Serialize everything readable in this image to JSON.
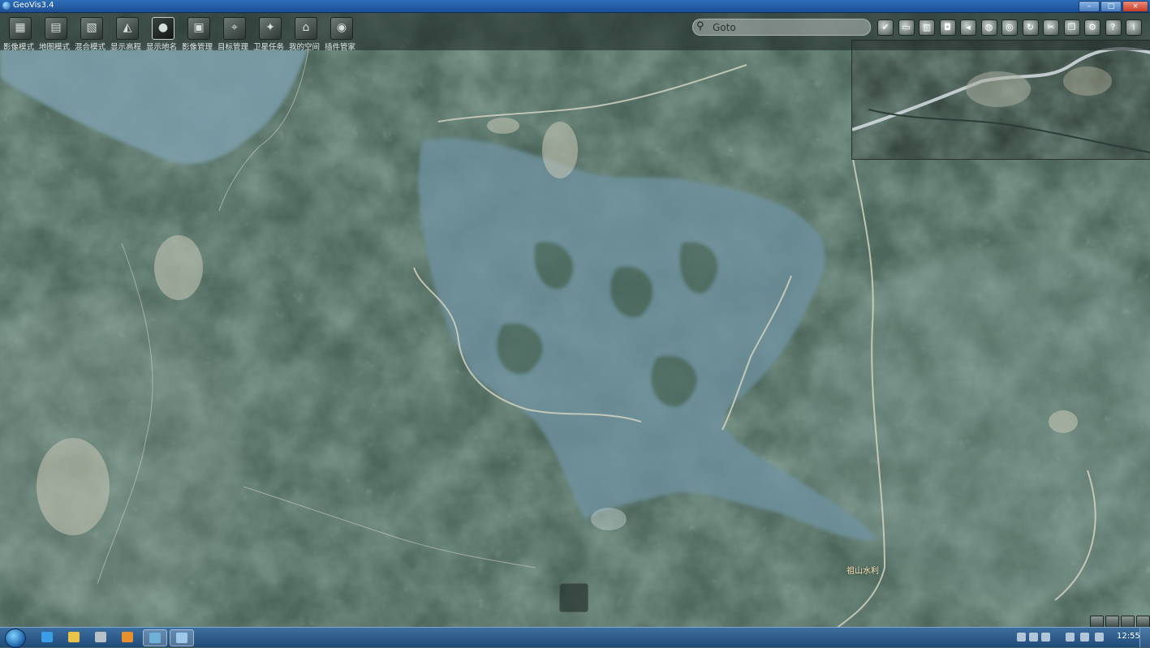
{
  "window": {
    "title": "GeoVis3.4",
    "controls": [
      "minimize",
      "maximize",
      "close"
    ]
  },
  "toolbar": {
    "tools": [
      {
        "label": "影像模式",
        "icon": "image-mode-icon",
        "glyph": "▦"
      },
      {
        "label": "地图模式",
        "icon": "map-mode-icon",
        "glyph": "▤"
      },
      {
        "label": "混合模式",
        "icon": "hybrid-mode-icon",
        "glyph": "▧"
      },
      {
        "label": "显示高程",
        "icon": "elevation-icon",
        "glyph": "◭"
      },
      {
        "label": "显示地名",
        "icon": "place-names-icon",
        "glyph": "●"
      },
      {
        "label": "影像管理",
        "icon": "image-manager-icon",
        "glyph": "▣"
      },
      {
        "label": "目标管理",
        "icon": "target-manager-icon",
        "glyph": "⌖"
      },
      {
        "label": "卫星任务",
        "icon": "satellite-task-icon",
        "glyph": "✦"
      },
      {
        "label": "我的空间",
        "icon": "my-space-icon",
        "glyph": "⌂"
      },
      {
        "label": "插件管家",
        "icon": "plugin-manager-icon",
        "glyph": "◉"
      }
    ],
    "active_tool": "显示地名"
  },
  "search": {
    "placeholder": "Goto",
    "value": ""
  },
  "right_tools": [
    {
      "icon": "check-icon",
      "glyph": "✔"
    },
    {
      "icon": "screen-icon",
      "glyph": "▭"
    },
    {
      "icon": "layers-icon",
      "glyph": "▥"
    },
    {
      "icon": "camera-icon",
      "glyph": "◘"
    },
    {
      "icon": "speaker-icon",
      "glyph": "◂"
    },
    {
      "icon": "globe-icon",
      "glyph": "◍"
    },
    {
      "icon": "earth-icon",
      "glyph": "◎"
    },
    {
      "icon": "refresh-icon",
      "glyph": "↻"
    },
    {
      "icon": "tools-icon",
      "glyph": "✂"
    },
    {
      "icon": "window-icon",
      "glyph": "❐"
    },
    {
      "icon": "settings-icon",
      "glyph": "⚙"
    },
    {
      "icon": "help-icon",
      "glyph": "?"
    },
    {
      "icon": "info-icon",
      "glyph": "i"
    }
  ],
  "map": {
    "place_label": "祖山水利"
  },
  "taskbar": {
    "apps": [
      {
        "icon": "ie-icon",
        "color": "#3a9ee6"
      },
      {
        "icon": "folder-icon",
        "color": "#e8c24a"
      },
      {
        "icon": "app-icon",
        "color": "#b8c0c8"
      },
      {
        "icon": "media-icon",
        "color": "#e89030"
      },
      {
        "icon": "geovis-icon",
        "color": "#6fb0d8"
      },
      {
        "icon": "window-app-icon",
        "color": "#9ec8e8"
      }
    ],
    "clock": "12:55"
  }
}
